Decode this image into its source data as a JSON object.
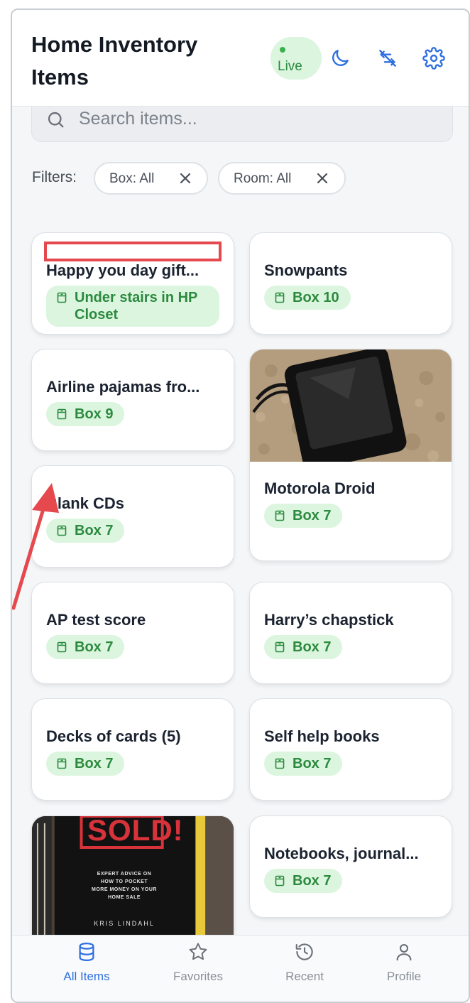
{
  "header": {
    "title": "Home Inventory Items",
    "live_label": "Live",
    "icons": [
      "moon-icon",
      "sync-off-icon",
      "gear-icon"
    ]
  },
  "search": {
    "placeholder": "Search items..."
  },
  "filters": {
    "label": "Filters:",
    "chips": [
      "Box: All",
      "Room: All"
    ]
  },
  "items": [
    {
      "name": "Happy you day gift...",
      "location": "Under stairs in HP Closet"
    },
    {
      "name": "Snowpants",
      "location": "Box 10"
    },
    {
      "name": "Airline pajamas fro...",
      "location": "Box 9"
    },
    {
      "name": "Motorola Droid",
      "location": "Box 7",
      "has_photo": true
    },
    {
      "name": "Blank CDs",
      "location": "Box 7"
    },
    {
      "name": "AP test score",
      "location": "Box 7"
    },
    {
      "name": "Harry’s chapstick",
      "location": "Box 7"
    },
    {
      "name": "Decks of cards (5)",
      "location": "Box 7"
    },
    {
      "name": "Self help books",
      "location": "Box 7"
    },
    {
      "name": "",
      "location": "",
      "has_photo": true,
      "photo_text": [
        "SOLD!",
        "EXPERT ADVICE ON",
        "HOW TO POCKET",
        "MORE MONEY ON YOUR",
        "HOME SALE",
        "KRIS LINDAHL"
      ]
    },
    {
      "name": "Notebooks, journal...",
      "location": "Box 7"
    }
  ],
  "nav": {
    "items": [
      {
        "label": "All Items",
        "icon": "database-icon",
        "active": true
      },
      {
        "label": "Favorites",
        "icon": "star-icon"
      },
      {
        "label": "Recent",
        "icon": "history-icon"
      },
      {
        "label": "Profile",
        "icon": "user-icon"
      }
    ]
  },
  "colors": {
    "accent": "#2f6fe0",
    "badge_bg": "#dcf5df",
    "badge_text": "#2b8a3e",
    "annotation_red": "#e5484d"
  }
}
